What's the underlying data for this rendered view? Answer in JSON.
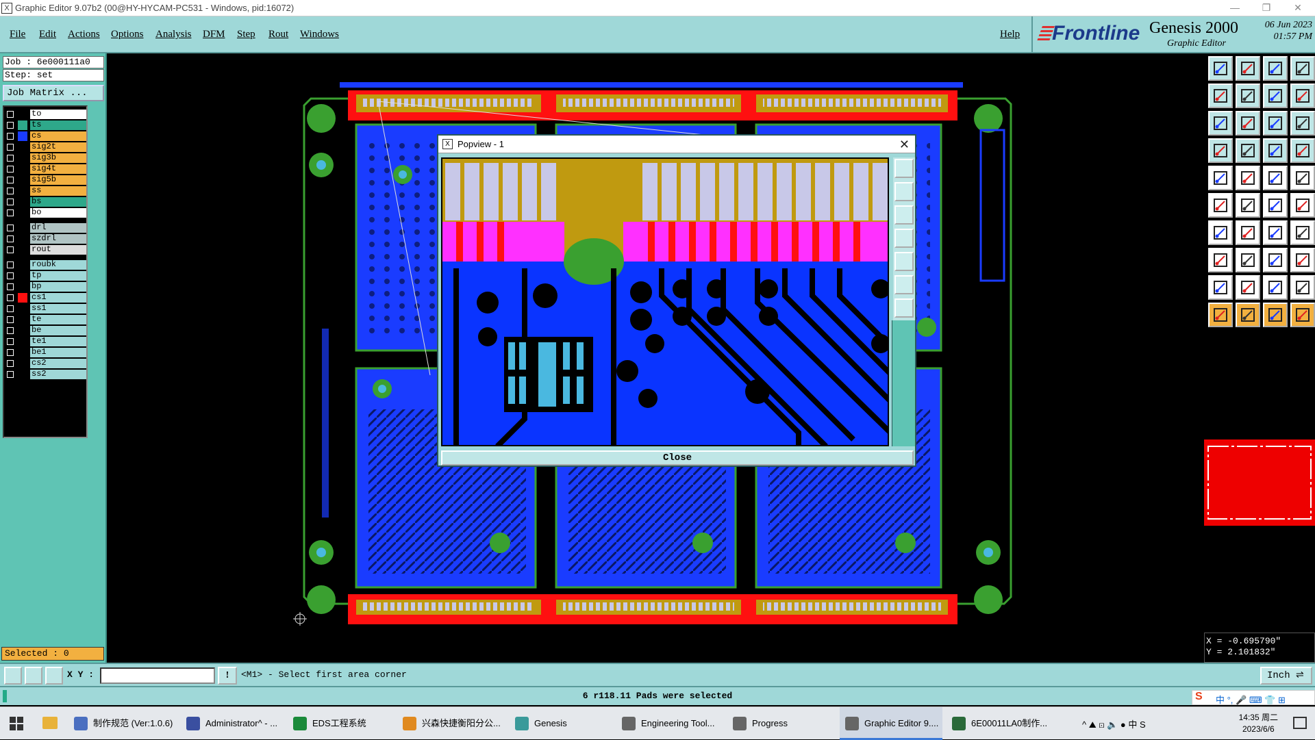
{
  "window": {
    "title": "Graphic Editor 9.07b2 (00@HY-HYCAM-PC531 - Windows, pid:16072)",
    "minimize": "—",
    "restore": "❐",
    "close": "✕",
    "app_icon": "X"
  },
  "menu": {
    "file": "File",
    "edit": "Edit",
    "actions": "Actions",
    "options": "Options",
    "analysis": "Analysis",
    "dfm": "DFM",
    "step": "Step",
    "rout": "Rout",
    "windows": "Windows",
    "help": "Help"
  },
  "brand": {
    "logo": "Frontline",
    "product": "Genesis 2000",
    "subtitle": "Graphic Editor",
    "date": "06 Jun 2023",
    "time": "01:57 PM"
  },
  "job": {
    "job_label": "Job : 6e000111a0",
    "step_label": "Step: set",
    "job_matrix": "Job Matrix ..."
  },
  "layers": [
    {
      "name": "to",
      "color": "#ffffff",
      "swatch": "#000000",
      "group": 1
    },
    {
      "name": "ts",
      "color": "#2ea88a",
      "swatch": "#2ea88a",
      "group": 1
    },
    {
      "name": "cs",
      "color": "#f2b040",
      "swatch": "#1a3cff",
      "group": 1
    },
    {
      "name": "sig2t",
      "color": "#f2b040",
      "swatch": "#000000",
      "group": 1
    },
    {
      "name": "sig3b",
      "color": "#f2b040",
      "swatch": "#000000",
      "group": 1
    },
    {
      "name": "sig4t",
      "color": "#f2b040",
      "swatch": "#000000",
      "group": 1
    },
    {
      "name": "sig5b",
      "color": "#f2b040",
      "swatch": "#000000",
      "group": 1
    },
    {
      "name": "ss",
      "color": "#f2b040",
      "swatch": "#000000",
      "group": 1
    },
    {
      "name": "bs",
      "color": "#2ea88a",
      "swatch": "#000000",
      "group": 1
    },
    {
      "name": "bo",
      "color": "#ffffff",
      "swatch": "#000000",
      "group": 1
    },
    {
      "name": "drl",
      "color": "#b0c4c4",
      "swatch": "#000000",
      "group": 2
    },
    {
      "name": "szdrl",
      "color": "#b0c4c4",
      "swatch": "#000000",
      "group": 2
    },
    {
      "name": "rout",
      "color": "#dddddd",
      "swatch": "#000000",
      "group": 2
    },
    {
      "name": "roubk",
      "color": "#9fd8d8",
      "swatch": "#000000",
      "group": 3
    },
    {
      "name": "tp",
      "color": "#9fd8d8",
      "swatch": "#000000",
      "group": 3
    },
    {
      "name": "bp",
      "color": "#9fd8d8",
      "swatch": "#000000",
      "group": 3
    },
    {
      "name": "cs1",
      "color": "#9fd8d8",
      "swatch": "#ff1010",
      "group": 3,
      "mark": "■"
    },
    {
      "name": "ss1",
      "color": "#9fd8d8",
      "swatch": "#000000",
      "group": 3
    },
    {
      "name": "te",
      "color": "#9fd8d8",
      "swatch": "#000000",
      "group": 3
    },
    {
      "name": "be",
      "color": "#9fd8d8",
      "swatch": "#000000",
      "group": 3
    },
    {
      "name": "te1",
      "color": "#9fd8d8",
      "swatch": "#000000",
      "group": 3
    },
    {
      "name": "be1",
      "color": "#9fd8d8",
      "swatch": "#000000",
      "group": 3
    },
    {
      "name": "cs2",
      "color": "#9fd8d8",
      "swatch": "#000000",
      "group": 3
    },
    {
      "name": "ss2",
      "color": "#9fd8d8",
      "swatch": "#000000",
      "group": 3
    }
  ],
  "selected": "Selected : 0",
  "popup": {
    "title": "Popview - 1",
    "close_label": "Close",
    "close_x": "✕",
    "icon": "X"
  },
  "coords": {
    "x": "X = -0.695790\"",
    "y": "Y = 2.101832\""
  },
  "cmd": {
    "xy_label": "X Y :",
    "xy_value": "",
    "prompt_icon": "!",
    "prompt": "<M1> - Select first area corner",
    "unit": "Inch ⇌"
  },
  "status": "6 r118.11 Pads were selected",
  "ime": {
    "logo": "S",
    "items": "中 °, 🎤 ⌨ 👕 ⊞"
  },
  "taskbar": [
    {
      "label": "制作规范 (Ver:1.0.6)",
      "color": "#4a6fc0"
    },
    {
      "label": "Administrator^ - ...",
      "color": "#3a4fa0"
    },
    {
      "label": "EDS工程系统",
      "color": "#1a8a3a"
    },
    {
      "label": "兴森快捷衡阳分公...",
      "color": "#e08a20"
    },
    {
      "label": "Genesis",
      "color": "#3a9a9a"
    },
    {
      "label": "Engineering Tool...",
      "color": "#666666"
    },
    {
      "label": "Progress",
      "color": "#666666"
    },
    {
      "label": "Graphic Editor 9....",
      "color": "#666666",
      "active": true
    },
    {
      "label": "6E00011LA0制作...",
      "color": "#2a6a3a"
    }
  ],
  "tray": {
    "icons": "^ ⛰ ⊡ 🔈 ● 中 S",
    "time": "14:35 周二",
    "date": "2023/6/6"
  },
  "colors": {
    "panel": "#9fd8d8",
    "accent": "#5fc4b4",
    "board_blue": "#0a34ff",
    "pad_red": "#ff1010",
    "magenta": "#ff30ff",
    "copper": "#c09a10",
    "green": "#3aa030"
  }
}
